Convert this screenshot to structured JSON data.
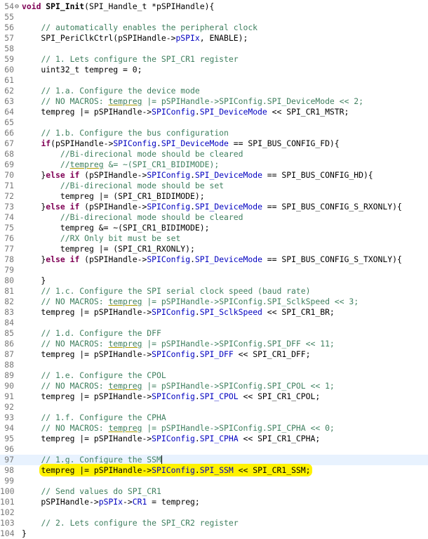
{
  "editor": {
    "highlight_color": "#fff200",
    "current_line_color": "#e8f2fe",
    "lines": [
      {
        "n": "54",
        "fold": "⊖",
        "parts": [
          [
            "kw",
            "void "
          ],
          [
            "fn",
            "SPI_Init"
          ],
          [
            "",
            "(SPI_Handle_t *pSPIHandle){"
          ]
        ]
      },
      {
        "n": "55",
        "parts": []
      },
      {
        "n": "56",
        "parts": [
          [
            "",
            "    "
          ],
          [
            "cm",
            "// automatically enables the peripheral clock"
          ]
        ]
      },
      {
        "n": "57",
        "parts": [
          [
            "",
            "    SPI_PeriClkCtrl(pSPIHandle->"
          ],
          [
            "fld",
            "pSPIx"
          ],
          [
            "",
            ", ENABLE);"
          ]
        ]
      },
      {
        "n": "58",
        "parts": []
      },
      {
        "n": "59",
        "parts": [
          [
            "",
            "    "
          ],
          [
            "cm",
            "// 1. Lets configure the SPI_CR1 register"
          ]
        ]
      },
      {
        "n": "60",
        "parts": [
          [
            "",
            "    uint32_t tempreg = 0;"
          ]
        ]
      },
      {
        "n": "61",
        "parts": []
      },
      {
        "n": "62",
        "parts": [
          [
            "",
            "    "
          ],
          [
            "cm",
            "// 1.a. Configure the device mode"
          ]
        ]
      },
      {
        "n": "63",
        "parts": [
          [
            "",
            "    "
          ],
          [
            "cm",
            "// NO MACROS: "
          ],
          [
            "cm ul",
            "tempreg"
          ],
          [
            "cm",
            " |= pSPIHandle->SPIConfig.SPI_DeviceMode << 2;"
          ]
        ]
      },
      {
        "n": "64",
        "parts": [
          [
            "",
            "    tempreg |= pSPIHandle->"
          ],
          [
            "fld",
            "SPIConfig"
          ],
          [
            "",
            "."
          ],
          [
            "fld",
            "SPI_DeviceMode"
          ],
          [
            "",
            " << SPI_CR1_MSTR;"
          ]
        ]
      },
      {
        "n": "65",
        "parts": []
      },
      {
        "n": "66",
        "parts": [
          [
            "",
            "    "
          ],
          [
            "cm",
            "// 1.b. Configure the bus configuration"
          ]
        ]
      },
      {
        "n": "67",
        "parts": [
          [
            "",
            "    "
          ],
          [
            "kw",
            "if"
          ],
          [
            "",
            "(pSPIHandle->"
          ],
          [
            "fld",
            "SPIConfig"
          ],
          [
            "",
            "."
          ],
          [
            "fld",
            "SPI_DeviceMode"
          ],
          [
            "",
            " == SPI_BUS_CONFIG_FD){"
          ]
        ]
      },
      {
        "n": "68",
        "parts": [
          [
            "",
            "        "
          ],
          [
            "cm",
            "//Bi-direcional mode should be cleared"
          ]
        ]
      },
      {
        "n": "69",
        "parts": [
          [
            "",
            "        "
          ],
          [
            "cm",
            "//"
          ],
          [
            "cm ul",
            "tempreg"
          ],
          [
            "cm",
            " &= ~(SPI_CR1_BIDIMODE);"
          ]
        ]
      },
      {
        "n": "70",
        "parts": [
          [
            "",
            "    }"
          ],
          [
            "kw",
            "else if"
          ],
          [
            "",
            " (pSPIHandle->"
          ],
          [
            "fld",
            "SPIConfig"
          ],
          [
            "",
            "."
          ],
          [
            "fld",
            "SPI_DeviceMode"
          ],
          [
            "",
            " == SPI_BUS_CONFIG_HD){"
          ]
        ]
      },
      {
        "n": "71",
        "parts": [
          [
            "",
            "        "
          ],
          [
            "cm",
            "//Bi-direcional mode should be set"
          ]
        ]
      },
      {
        "n": "72",
        "parts": [
          [
            "",
            "        tempreg |= (SPI_CR1_BIDIMODE);"
          ]
        ]
      },
      {
        "n": "73",
        "parts": [
          [
            "",
            "    }"
          ],
          [
            "kw",
            "else if"
          ],
          [
            "",
            " (pSPIHandle->"
          ],
          [
            "fld",
            "SPIConfig"
          ],
          [
            "",
            "."
          ],
          [
            "fld",
            "SPI_DeviceMode"
          ],
          [
            "",
            " == SPI_BUS_CONFIG_S_RXONLY){"
          ]
        ]
      },
      {
        "n": "74",
        "parts": [
          [
            "",
            "        "
          ],
          [
            "cm",
            "//Bi-direcional mode should be cleared"
          ]
        ]
      },
      {
        "n": "75",
        "parts": [
          [
            "",
            "        tempreg &= ~(SPI_CR1_BIDIMODE);"
          ]
        ]
      },
      {
        "n": "76",
        "parts": [
          [
            "",
            "        "
          ],
          [
            "cm",
            "//RX Only bit must be set"
          ]
        ]
      },
      {
        "n": "77",
        "parts": [
          [
            "",
            "        tempreg |= (SPI_CR1_RXONLY);"
          ]
        ]
      },
      {
        "n": "78",
        "parts": [
          [
            "",
            "    }"
          ],
          [
            "kw",
            "else if"
          ],
          [
            "",
            " (pSPIHandle->"
          ],
          [
            "fld",
            "SPIConfig"
          ],
          [
            "",
            "."
          ],
          [
            "fld",
            "SPI_DeviceMode"
          ],
          [
            "",
            " == SPI_BUS_CONFIG_S_TXONLY){"
          ]
        ]
      },
      {
        "n": "79",
        "parts": []
      },
      {
        "n": "80",
        "parts": [
          [
            "",
            "    }"
          ]
        ]
      },
      {
        "n": "81",
        "parts": [
          [
            "",
            "    "
          ],
          [
            "cm",
            "// 1.c. Configure the SPI serial clock speed (baud rate)"
          ]
        ]
      },
      {
        "n": "82",
        "parts": [
          [
            "",
            "    "
          ],
          [
            "cm",
            "// NO MACROS: "
          ],
          [
            "cm ul",
            "tempreg"
          ],
          [
            "cm",
            " |= pSPIHandle->SPIConfig.SPI_SclkSpeed << 3;"
          ]
        ]
      },
      {
        "n": "83",
        "parts": [
          [
            "",
            "    tempreg |= pSPIHandle->"
          ],
          [
            "fld",
            "SPIConfig"
          ],
          [
            "",
            "."
          ],
          [
            "fld",
            "SPI_SclkSpeed"
          ],
          [
            "",
            " << SPI_CR1_BR;"
          ]
        ]
      },
      {
        "n": "84",
        "parts": []
      },
      {
        "n": "85",
        "parts": [
          [
            "",
            "    "
          ],
          [
            "cm",
            "// 1.d. Configure the DFF"
          ]
        ]
      },
      {
        "n": "86",
        "parts": [
          [
            "",
            "    "
          ],
          [
            "cm",
            "// NO MACROS: "
          ],
          [
            "cm ul",
            "tempreg"
          ],
          [
            "cm",
            " |= pSPIHandle->SPIConfig.SPI_DFF << 11;"
          ]
        ]
      },
      {
        "n": "87",
        "parts": [
          [
            "",
            "    tempreg |= pSPIHandle->"
          ],
          [
            "fld",
            "SPIConfig"
          ],
          [
            "",
            "."
          ],
          [
            "fld",
            "SPI_DFF"
          ],
          [
            "",
            " << SPI_CR1_DFF;"
          ]
        ]
      },
      {
        "n": "88",
        "parts": []
      },
      {
        "n": "89",
        "parts": [
          [
            "",
            "    "
          ],
          [
            "cm",
            "// 1.e. Configure the CPOL"
          ]
        ]
      },
      {
        "n": "90",
        "parts": [
          [
            "",
            "    "
          ],
          [
            "cm",
            "// NO MACROS: "
          ],
          [
            "cm ul",
            "tempreg"
          ],
          [
            "cm",
            " |= pSPIHandle->SPIConfig.SPI_CPOL << 1;"
          ]
        ]
      },
      {
        "n": "91",
        "parts": [
          [
            "",
            "    tempreg |= pSPIHandle->"
          ],
          [
            "fld",
            "SPIConfig"
          ],
          [
            "",
            "."
          ],
          [
            "fld",
            "SPI_CPOL"
          ],
          [
            "",
            " << SPI_CR1_CPOL;"
          ]
        ]
      },
      {
        "n": "92",
        "parts": []
      },
      {
        "n": "93",
        "parts": [
          [
            "",
            "    "
          ],
          [
            "cm",
            "// 1.f. Configure the CPHA"
          ]
        ]
      },
      {
        "n": "94",
        "parts": [
          [
            "",
            "    "
          ],
          [
            "cm",
            "// NO MACROS: "
          ],
          [
            "cm ul",
            "tempreg"
          ],
          [
            "cm",
            " |= pSPIHandle->SPIConfig.SPI_CPHA << 0;"
          ]
        ]
      },
      {
        "n": "95",
        "parts": [
          [
            "",
            "    tempreg |= pSPIHandle->"
          ],
          [
            "fld",
            "SPIConfig"
          ],
          [
            "",
            "."
          ],
          [
            "fld",
            "SPI_CPHA"
          ],
          [
            "",
            " << SPI_CR1_CPHA;"
          ]
        ]
      },
      {
        "n": "96",
        "parts": []
      },
      {
        "n": "97",
        "current": true,
        "caret": true,
        "parts": [
          [
            "",
            "    "
          ],
          [
            "cm",
            "// 1.g. Configure the SSM"
          ]
        ]
      },
      {
        "n": "98",
        "highlight": true,
        "parts": [
          [
            "",
            "tempreg |= pSPIHandle->"
          ],
          [
            "fld",
            "SPIConfig"
          ],
          [
            "",
            "."
          ],
          [
            "fld",
            "SPI_SSM"
          ],
          [
            "",
            " << SPI_CR1_SSM;"
          ]
        ],
        "indent": "    "
      },
      {
        "n": "99",
        "parts": []
      },
      {
        "n": "100",
        "parts": [
          [
            "",
            "    "
          ],
          [
            "cm",
            "// Send values do SPI_CR1"
          ]
        ]
      },
      {
        "n": "101",
        "parts": [
          [
            "",
            "    pSPIHandle->"
          ],
          [
            "fld",
            "pSPIx"
          ],
          [
            "",
            "->"
          ],
          [
            "fld",
            "CR1"
          ],
          [
            "",
            " = tempreg;"
          ]
        ]
      },
      {
        "n": "102",
        "parts": []
      },
      {
        "n": "103",
        "parts": [
          [
            "",
            "    "
          ],
          [
            "cm",
            "// 2. Lets configure the SPI_CR2 register"
          ]
        ]
      },
      {
        "n": "104",
        "parts": [
          [
            "",
            "}"
          ]
        ]
      }
    ]
  }
}
